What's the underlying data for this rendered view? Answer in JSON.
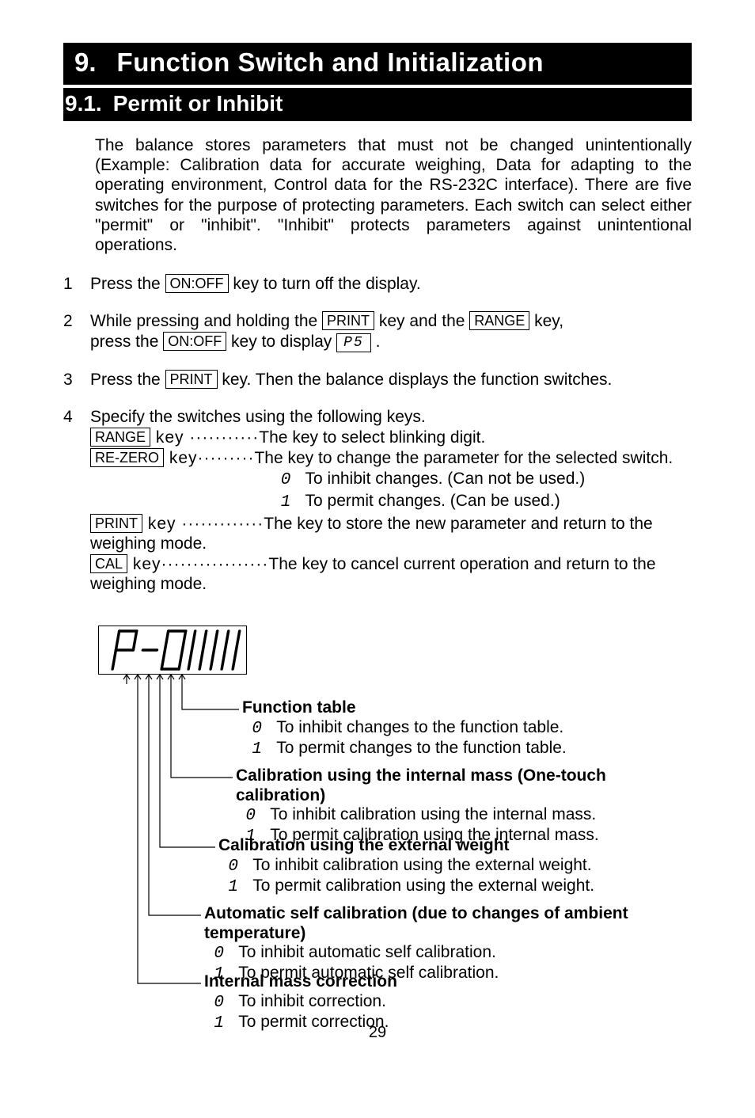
{
  "chapter": {
    "num": "9.",
    "title": "Function Switch and Initialization"
  },
  "section": {
    "num": "9.1.",
    "title": "Permit or Inhibit"
  },
  "intro": "The balance stores parameters that must not be changed unintentionally (Example: Calibration data for accurate weighing, Data for adapting to the operating environment, Control data for the RS-232C interface). There are five switches for the purpose of protecting parameters. Each switch can select either \"permit\" or \"inhibit\". \"Inhibit\" protects parameters against unintentional operations.",
  "keys": {
    "onoff": "ON:OFF",
    "print": "PRINT",
    "range": "RANGE",
    "rezero": "RE-ZERO",
    "cal": "CAL"
  },
  "seg": {
    "p5": "P5",
    "zero": "0",
    "one": "1"
  },
  "steps": {
    "s1a": "Press the ",
    "s1b": " key to turn off the display.",
    "s2a": "While pressing and holding the ",
    "s2b": " key and the ",
    "s2c": " key,",
    "s2d": "press the ",
    "s2e": " key to display ",
    "s2f": " .",
    "s3a": "Press the ",
    "s3b": " key. Then the balance displays the function switches.",
    "s4a": "Specify the switches using the following keys.",
    "range_a": " key ···········",
    "range_b": "The key to select blinking digit.",
    "rezero_a": " key·········",
    "rezero_b": "The key to change the parameter for the selected switch.",
    "inhibit_label": "To inhibit changes. (Can not be used.)",
    "permit_label": "To permit changes. (Can be used.)",
    "print_a": " key ·············",
    "print_b": "The key to store the new parameter and return to the weighing mode.",
    "cal_a": " key·················",
    "cal_b": "The key to cancel current operation and return to the weighing mode."
  },
  "tree": {
    "ft": {
      "title": "Function table",
      "i": "To inhibit changes to the function table.",
      "p": "To permit changes to the function table."
    },
    "cim": {
      "title": "Calibration using the internal mass (One-touch calibration)",
      "i": "To inhibit calibration using the internal mass.",
      "p": "To permit calibration using the internal mass."
    },
    "cew": {
      "title": "Calibration using the external weight",
      "i": "To inhibit calibration using the external weight.",
      "p": "To permit calibration using the external weight."
    },
    "asc": {
      "title": "Automatic self calibration (due to changes of ambient temperature)",
      "i": "To inhibit automatic self calibration.",
      "p": "To permit automatic self calibration."
    },
    "imc": {
      "title": "Internal mass correction",
      "i": "To inhibit correction.",
      "p": "To permit correction."
    }
  },
  "page_number": "29"
}
